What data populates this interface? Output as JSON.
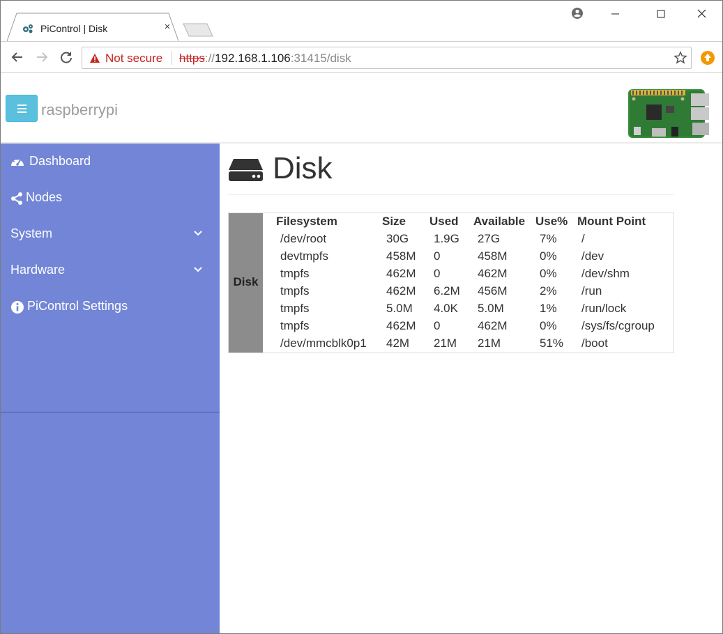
{
  "browser": {
    "tab_title": "PiControl | Disk",
    "tab_close": "×",
    "omnibox": {
      "security_label": "Not secure",
      "url_scheme": "https",
      "url_sep": "://",
      "url_host": "192.168.1.106",
      "url_rest": ":31415/disk"
    }
  },
  "navbar": {
    "brand": "raspberrypi"
  },
  "sidebar": {
    "items": [
      {
        "label": "Dashboard",
        "icon": "dashboard-icon",
        "has_submenu": false
      },
      {
        "label": "Nodes",
        "icon": "share-icon",
        "has_submenu": false
      },
      {
        "label": "System",
        "icon": null,
        "has_submenu": true
      },
      {
        "label": "Hardware",
        "icon": null,
        "has_submenu": true
      },
      {
        "label": "PiControl Settings",
        "icon": "info-circle-icon",
        "has_submenu": false
      }
    ]
  },
  "main": {
    "title": "Disk",
    "table": {
      "row_label": "Disk",
      "headers": [
        "Filesystem",
        "Size",
        "Used",
        "Available",
        "Use%",
        "Mount Point"
      ],
      "rows": [
        [
          "/dev/root",
          "30G",
          "1.9G",
          "27G",
          "7%",
          "/"
        ],
        [
          "devtmpfs",
          "458M",
          "0",
          "458M",
          "0%",
          "/dev"
        ],
        [
          "tmpfs",
          "462M",
          "0",
          "462M",
          "0%",
          "/dev/shm"
        ],
        [
          "tmpfs",
          "462M",
          "6.2M",
          "456M",
          "2%",
          "/run"
        ],
        [
          "tmpfs",
          "5.0M",
          "4.0K",
          "5.0M",
          "1%",
          "/run/lock"
        ],
        [
          "tmpfs",
          "462M",
          "0",
          "462M",
          "0%",
          "/sys/fs/cgroup"
        ],
        [
          "/dev/mmcblk0p1",
          "42M",
          "21M",
          "21M",
          "51%",
          "/boot"
        ]
      ]
    }
  },
  "colors": {
    "sidebar_bg": "#7285d6",
    "toggle_bg": "#5bc0de",
    "disk_label_bg": "#8c8c8c",
    "not_secure": "#c5221f"
  }
}
